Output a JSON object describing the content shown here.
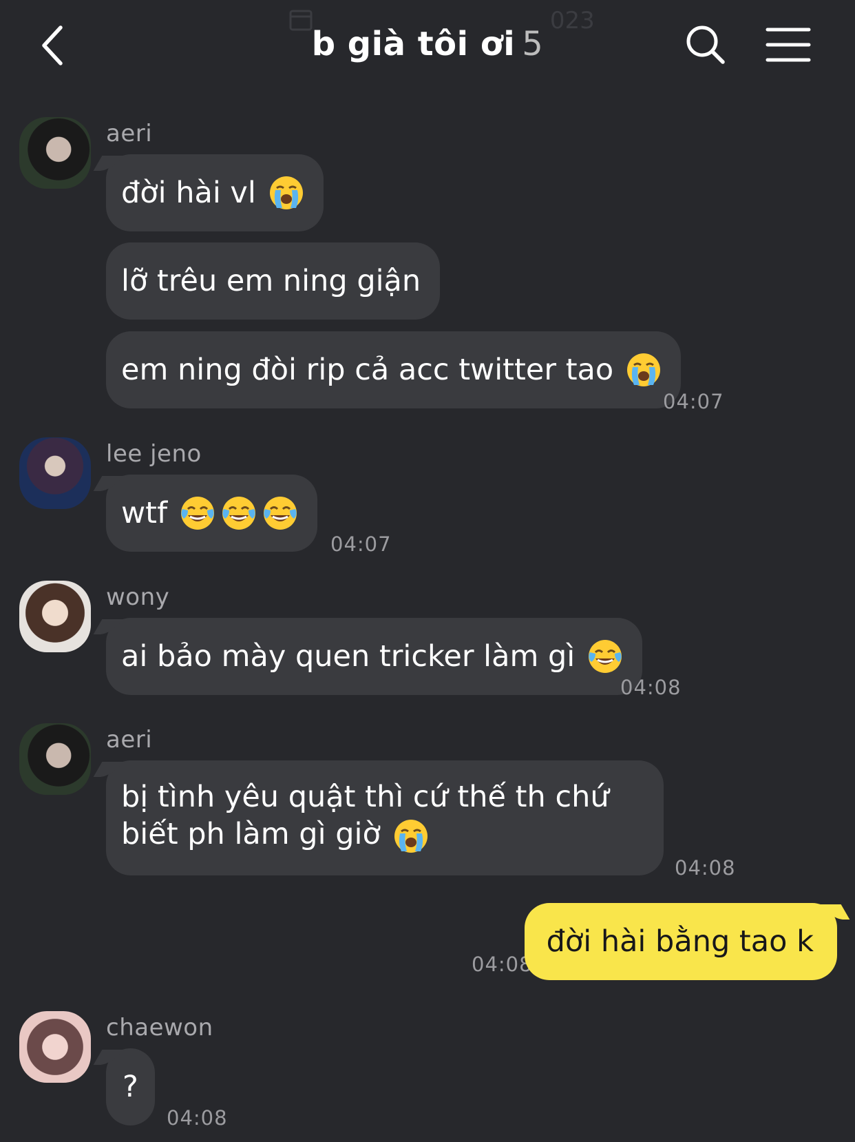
{
  "header": {
    "title": "b già tôi ơi",
    "member_count": "5",
    "ghost_date": "023"
  },
  "messages": [
    {
      "sender": "aeri",
      "bubbles": [
        "đời hài vl",
        "lỡ trêu em ning giận",
        "em ning đòi rip cả acc twitter tao"
      ],
      "time": "04:07",
      "emojis": [
        "loudly-crying-face",
        "loudly-crying-face"
      ]
    },
    {
      "sender": "lee jeno",
      "bubbles": [
        "wtf"
      ],
      "time": "04:07",
      "emojis": [
        "face-with-tears-of-joy",
        "face-with-tears-of-joy",
        "face-with-tears-of-joy"
      ]
    },
    {
      "sender": "wony",
      "bubbles": [
        "ai bảo mày quen tricker làm gì"
      ],
      "time": "04:08",
      "emojis": [
        "face-with-tears-of-joy"
      ]
    },
    {
      "sender": "aeri",
      "bubbles": [
        "bị tình yêu quật thì cứ thế th chứ biết ph làm gì giờ"
      ],
      "time": "04:08",
      "emojis": [
        "loudly-crying-face"
      ]
    },
    {
      "sender": "me",
      "bubbles": [
        "đời hài bằng tao k"
      ],
      "time": "04:08"
    },
    {
      "sender": "chaewon",
      "bubbles": [
        "?"
      ],
      "time": "04:08"
    }
  ],
  "colors": {
    "background": "#27282c",
    "bubble_other": "#3a3b3f",
    "bubble_me": "#f9e54b",
    "timestamp": "#9c9ca0"
  },
  "icons": [
    "chevron-left-icon",
    "calendar-icon",
    "search-icon",
    "hamburger-menu-icon"
  ]
}
